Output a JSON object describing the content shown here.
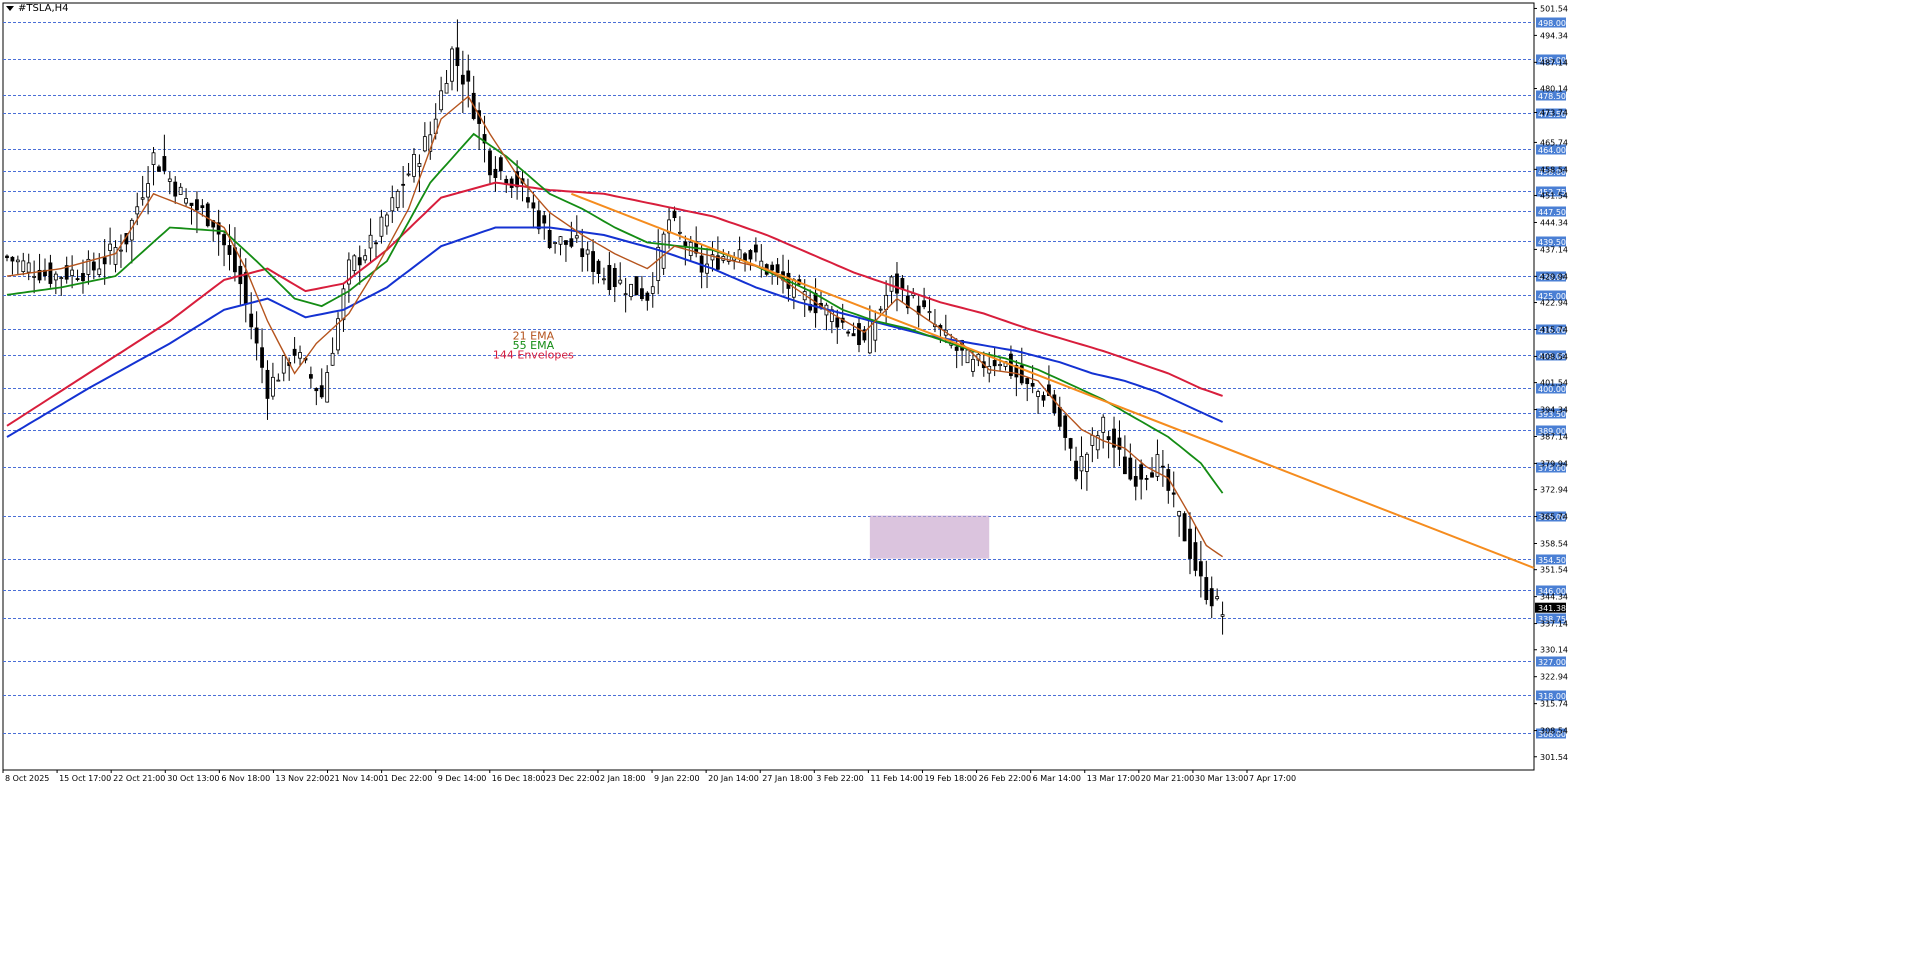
{
  "symbol": "#TSLA,H4",
  "colors": {
    "background": "#ffffff",
    "grid": "#4a6fd6",
    "candle": "#000000",
    "ema21": "#b5541d",
    "ema55": "#148c14",
    "envelope_upper": "#d81e3c",
    "envelope_lower": "#1432d2",
    "trendline": "#f58c1e",
    "zone_fill": "#c8a5cd",
    "price_label_bg": "#4a7fd4",
    "current_price_bg": "#000000"
  },
  "chart_data": {
    "type": "candlestick",
    "title": "",
    "ylim": [
      298.0,
      503.0
    ],
    "axis_ticks": [
      "501.54",
      "494.34",
      "487.14",
      "480.14",
      "473.74",
      "465.74",
      "458.54",
      "451.54",
      "444.34",
      "437.14",
      "429.94",
      "422.94",
      "415.74",
      "408.54",
      "401.54",
      "394.34",
      "387.14",
      "379.94",
      "372.94",
      "365.74",
      "358.54",
      "351.54",
      "344.34",
      "337.14",
      "330.14",
      "322.94",
      "315.74",
      "308.54",
      "301.54"
    ],
    "horizontal_levels": [
      "498.00",
      "488.00",
      "478.50",
      "473.50",
      "464.00",
      "458.00",
      "452.75",
      "447.50",
      "439.50",
      "430.00",
      "425.00",
      "416.00",
      "409.00",
      "400.00",
      "393.50",
      "389.00",
      "379.00",
      "366.00",
      "354.50",
      "346.00",
      "338.75",
      "327.00",
      "318.00",
      "308.00"
    ],
    "current_price": "341.38",
    "x_labels": [
      "8 Oct 2025",
      "15 Oct 17:00",
      "22 Oct 21:00",
      "30 Oct 13:00",
      "6 Nov 18:00",
      "13 Nov 22:00",
      "21 Nov 14:00",
      "1 Dec 22:00",
      "9 Dec 14:00",
      "16 Dec 18:00",
      "23 Dec 22:00",
      "2 Jan 18:00",
      "9 Jan 22:00",
      "20 Jan 14:00",
      "27 Jan 18:00",
      "3 Feb 22:00",
      "11 Feb 14:00",
      "19 Feb 18:00",
      "26 Feb 22:00",
      "6 Mar 14:00",
      "13 Mar 17:00",
      "20 Mar 21:00",
      "30 Mar 13:00",
      "7 Apr 17:00"
    ],
    "series": [
      {
        "name": "21 EMA",
        "role": "ema21"
      },
      {
        "name": "55 EMA",
        "role": "ema55"
      },
      {
        "name": "144 Envelopes",
        "role": "envelope"
      }
    ],
    "anchors": {
      "close": [
        [
          0,
          435
        ],
        [
          8,
          430
        ],
        [
          16,
          432
        ],
        [
          22,
          440
        ],
        [
          27,
          462
        ],
        [
          33,
          450
        ],
        [
          38,
          445
        ],
        [
          43,
          428
        ],
        [
          48,
          400
        ],
        [
          53,
          410
        ],
        [
          58,
          398
        ],
        [
          63,
          432
        ],
        [
          68,
          440
        ],
        [
          73,
          455
        ],
        [
          78,
          468
        ],
        [
          82,
          490
        ],
        [
          85,
          480
        ],
        [
          89,
          460
        ],
        [
          94,
          455
        ],
        [
          100,
          440
        ],
        [
          105,
          438
        ],
        [
          110,
          430
        ],
        [
          118,
          425
        ],
        [
          122,
          445
        ],
        [
          128,
          432
        ],
        [
          135,
          438
        ],
        [
          140,
          432
        ],
        [
          146,
          425
        ],
        [
          152,
          420
        ],
        [
          158,
          412
        ],
        [
          163,
          428
        ],
        [
          168,
          422
        ],
        [
          173,
          413
        ],
        [
          178,
          406
        ],
        [
          183,
          408
        ],
        [
          188,
          400
        ],
        [
          192,
          398
        ],
        [
          197,
          378
        ],
        [
          202,
          390
        ],
        [
          207,
          376
        ],
        [
          212,
          380
        ],
        [
          216,
          365
        ],
        [
          220,
          348
        ],
        [
          224,
          340
        ]
      ],
      "wick": [
        [
          0,
          4
        ],
        [
          30,
          7
        ],
        [
          60,
          5
        ],
        [
          70,
          6
        ],
        [
          82,
          8
        ],
        [
          100,
          6
        ],
        [
          140,
          5
        ],
        [
          180,
          5
        ],
        [
          210,
          6
        ],
        [
          224,
          6
        ]
      ],
      "ema21": [
        [
          0,
          430
        ],
        [
          10,
          432
        ],
        [
          20,
          436
        ],
        [
          27,
          452
        ],
        [
          34,
          448
        ],
        [
          40,
          443
        ],
        [
          44,
          432
        ],
        [
          48,
          418
        ],
        [
          53,
          404
        ],
        [
          57,
          412
        ],
        [
          63,
          420
        ],
        [
          68,
          432
        ],
        [
          74,
          448
        ],
        [
          80,
          472
        ],
        [
          85,
          478
        ],
        [
          89,
          468
        ],
        [
          94,
          457
        ],
        [
          100,
          447
        ],
        [
          106,
          441
        ],
        [
          112,
          436
        ],
        [
          118,
          432
        ],
        [
          123,
          438
        ],
        [
          128,
          436
        ],
        [
          134,
          434
        ],
        [
          140,
          432
        ],
        [
          146,
          426
        ],
        [
          152,
          420
        ],
        [
          158,
          415
        ],
        [
          164,
          424
        ],
        [
          170,
          418
        ],
        [
          176,
          412
        ],
        [
          181,
          405
        ],
        [
          186,
          404
        ],
        [
          190,
          402
        ],
        [
          194,
          395
        ],
        [
          198,
          389
        ],
        [
          202,
          386
        ],
        [
          206,
          384
        ],
        [
          210,
          379
        ],
        [
          214,
          376
        ],
        [
          218,
          366
        ],
        [
          221,
          358
        ],
        [
          224,
          355
        ]
      ],
      "ema55": [
        [
          0,
          425
        ],
        [
          10,
          427
        ],
        [
          20,
          430
        ],
        [
          30,
          443
        ],
        [
          40,
          442
        ],
        [
          46,
          434
        ],
        [
          53,
          424
        ],
        [
          58,
          422
        ],
        [
          63,
          426
        ],
        [
          70,
          434
        ],
        [
          78,
          455
        ],
        [
          86,
          468
        ],
        [
          92,
          462
        ],
        [
          100,
          452
        ],
        [
          106,
          448
        ],
        [
          112,
          443
        ],
        [
          118,
          439
        ],
        [
          124,
          438
        ],
        [
          130,
          437
        ],
        [
          136,
          434
        ],
        [
          142,
          430
        ],
        [
          148,
          426
        ],
        [
          154,
          421
        ],
        [
          160,
          418
        ],
        [
          166,
          416
        ],
        [
          172,
          413
        ],
        [
          178,
          410
        ],
        [
          184,
          408
        ],
        [
          190,
          405
        ],
        [
          196,
          401
        ],
        [
          202,
          397
        ],
        [
          208,
          392
        ],
        [
          214,
          387
        ],
        [
          220,
          380
        ],
        [
          224,
          372
        ]
      ],
      "envelope_upper": [
        [
          0,
          390
        ],
        [
          15,
          404
        ],
        [
          30,
          418
        ],
        [
          40,
          429
        ],
        [
          48,
          432
        ],
        [
          55,
          426
        ],
        [
          62,
          428
        ],
        [
          70,
          437
        ],
        [
          80,
          451
        ],
        [
          90,
          455
        ],
        [
          100,
          453
        ],
        [
          110,
          452
        ],
        [
          120,
          449
        ],
        [
          130,
          446
        ],
        [
          140,
          441
        ],
        [
          148,
          436
        ],
        [
          156,
          431
        ],
        [
          164,
          427
        ],
        [
          172,
          423
        ],
        [
          180,
          420
        ],
        [
          188,
          416
        ],
        [
          195,
          413
        ],
        [
          202,
          410
        ],
        [
          208,
          407
        ],
        [
          214,
          404
        ],
        [
          220,
          400
        ],
        [
          224,
          398
        ]
      ],
      "envelope_lower": [
        [
          0,
          387
        ],
        [
          15,
          400
        ],
        [
          30,
          412
        ],
        [
          40,
          421
        ],
        [
          48,
          424
        ],
        [
          55,
          419
        ],
        [
          62,
          421
        ],
        [
          70,
          427
        ],
        [
          80,
          438
        ],
        [
          90,
          443
        ],
        [
          100,
          443
        ],
        [
          110,
          441
        ],
        [
          120,
          437
        ],
        [
          130,
          432
        ],
        [
          138,
          427
        ],
        [
          146,
          423
        ],
        [
          154,
          420
        ],
        [
          162,
          417
        ],
        [
          170,
          414
        ],
        [
          178,
          412
        ],
        [
          186,
          410
        ],
        [
          194,
          407
        ],
        [
          200,
          404
        ],
        [
          206,
          402
        ],
        [
          212,
          399
        ],
        [
          218,
          395
        ],
        [
          224,
          391
        ]
      ]
    },
    "trendline": {
      "from": [
        104,
        452
      ],
      "to": [
        226,
        352
      ]
    },
    "zone": {
      "x_from": 159,
      "x_to": 181,
      "y_from": 354.5,
      "y_to": 366.0
    },
    "annotations": [
      {
        "text": "21 EMA",
        "role": "ema21",
        "x": 97,
        "y": 413
      },
      {
        "text": "55 EMA",
        "role": "ema55",
        "x": 97,
        "y": 410.5
      },
      {
        "text": "144 Envelopes",
        "role": "envelope",
        "x": 97,
        "y": 408
      }
    ]
  }
}
